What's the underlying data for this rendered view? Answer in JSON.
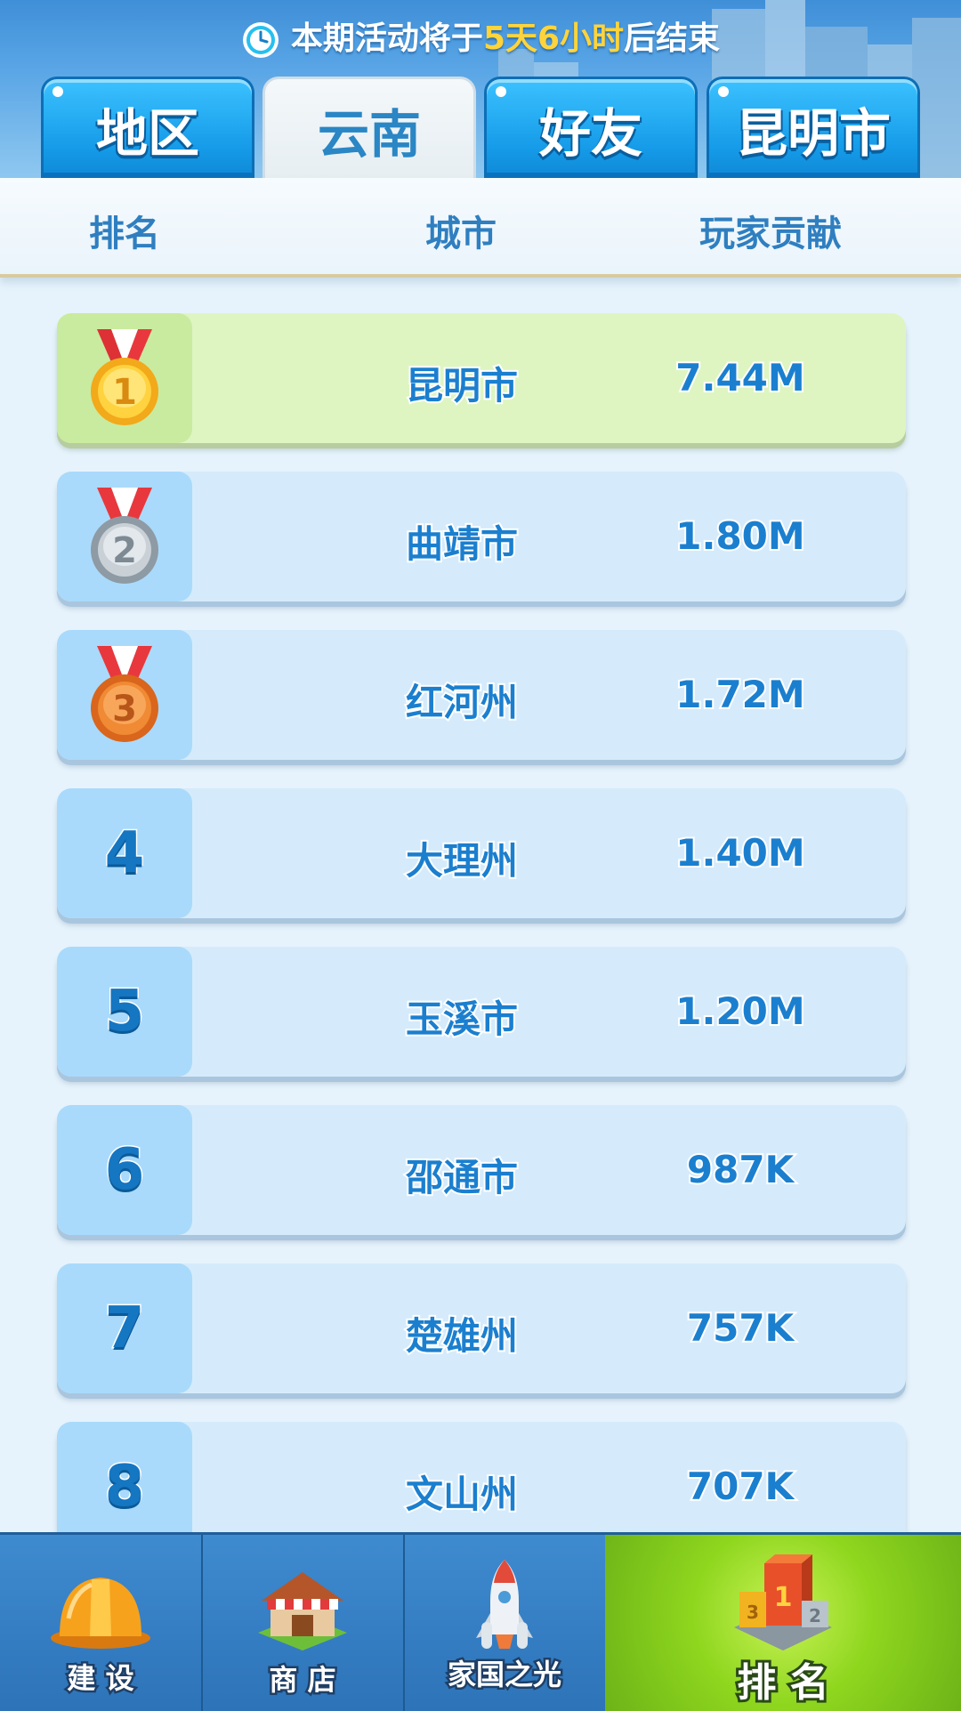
{
  "timer": {
    "prefix": "本期活动将于",
    "remaining": "5天6小时",
    "suffix": "后结束"
  },
  "tabs": [
    {
      "label": "地区",
      "active": false
    },
    {
      "label": "云南",
      "active": true
    },
    {
      "label": "好友",
      "active": false
    },
    {
      "label": "昆明市",
      "active": false
    }
  ],
  "columns": {
    "rank": "排名",
    "city": "城市",
    "contribution": "玩家贡献"
  },
  "rows": [
    {
      "rank": "1",
      "medal": "gold-medal-icon",
      "city": "昆明市",
      "score": "7.44M"
    },
    {
      "rank": "2",
      "medal": "silver-medal-icon",
      "city": "曲靖市",
      "score": "1.80M"
    },
    {
      "rank": "3",
      "medal": "bronze-medal-icon",
      "city": "红河州",
      "score": "1.72M"
    },
    {
      "rank": "4",
      "city": "大理州",
      "score": "1.40M"
    },
    {
      "rank": "5",
      "city": "玉溪市",
      "score": "1.20M"
    },
    {
      "rank": "6",
      "city": "邵通市",
      "score": "987K"
    },
    {
      "rank": "7",
      "city": "楚雄州",
      "score": "757K"
    },
    {
      "rank": "8",
      "city": "文山州",
      "score": "707K"
    }
  ],
  "nav": [
    {
      "label": "建 设",
      "icon": "hard-hat-icon"
    },
    {
      "label": "商 店",
      "icon": "shop-icon"
    },
    {
      "label": "家国之光",
      "icon": "rocket-icon"
    },
    {
      "label": "排 名",
      "icon": "podium-icon",
      "active": true
    }
  ],
  "colors": {
    "tab_blue": "#159be8",
    "highlight_yellow": "#ffd43b",
    "first_row_green": "#def5c2",
    "row_blue": "#d5ebfb",
    "nav_active_green": "#8ed61e"
  }
}
